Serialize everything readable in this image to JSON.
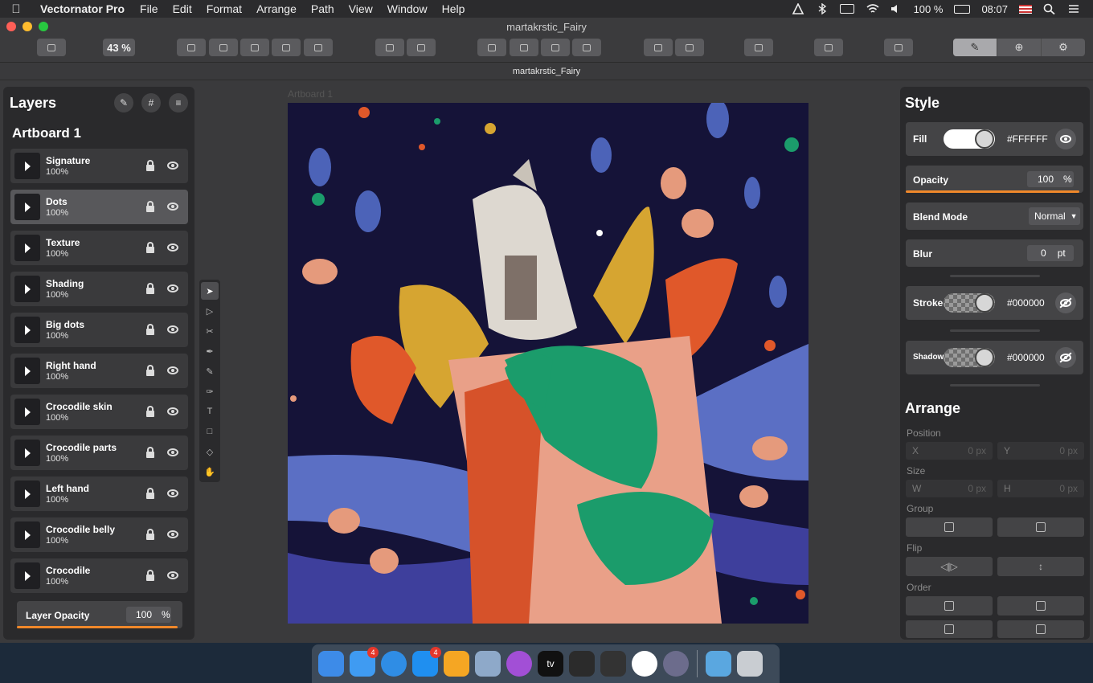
{
  "menubar": {
    "app_name": "Vectornator Pro",
    "menus": [
      "File",
      "Edit",
      "Format",
      "Arrange",
      "Path",
      "View",
      "Window",
      "Help"
    ],
    "battery": "100 %",
    "time": "08:07"
  },
  "window": {
    "title": "martakrstic_Fairy",
    "document_tab": "martakrstic_Fairy",
    "zoom": "43 %"
  },
  "layers_panel": {
    "title": "Layers",
    "artboard_name": "Artboard 1",
    "layers": [
      {
        "name": "Signature",
        "opacity": "100%"
      },
      {
        "name": "Dots",
        "opacity": "100%"
      },
      {
        "name": "Texture",
        "opacity": "100%"
      },
      {
        "name": "Shading",
        "opacity": "100%"
      },
      {
        "name": "Big dots",
        "opacity": "100%"
      },
      {
        "name": "Right hand",
        "opacity": "100%"
      },
      {
        "name": "Crocodile skin",
        "opacity": "100%"
      },
      {
        "name": "Crocodile parts",
        "opacity": "100%"
      },
      {
        "name": "Left hand",
        "opacity": "100%"
      },
      {
        "name": "Crocodile belly",
        "opacity": "100%"
      },
      {
        "name": "Crocodile",
        "opacity": "100%"
      }
    ],
    "layer_opacity_label": "Layer Opacity",
    "layer_opacity_value": "100",
    "percent_sign": "%"
  },
  "canvas": {
    "artboard_label": "Artboard 1"
  },
  "style_panel": {
    "title": "Style",
    "fill_label": "Fill",
    "fill_hex": "#FFFFFF",
    "opacity_label": "Opacity",
    "opacity_value": "100",
    "percent_sign": "%",
    "blend_label": "Blend Mode",
    "blend_value": "Normal",
    "blur_label": "Blur",
    "blur_value": "0",
    "blur_unit": "pt",
    "stroke_label": "Stroke",
    "stroke_hex": "#000000",
    "shadow_label": "Shadow",
    "shadow_hex": "#000000"
  },
  "arrange_panel": {
    "title": "Arrange",
    "position_label": "Position",
    "x_label": "X",
    "x_value": "0 px",
    "y_label": "Y",
    "y_value": "0 px",
    "size_label": "Size",
    "w_label": "W",
    "w_value": "0 px",
    "h_label": "H",
    "h_value": "0 px",
    "group_label": "Group",
    "flip_label": "Flip",
    "order_label": "Order"
  },
  "dock": {
    "messages_badge": "4",
    "appstore_badge": "4",
    "tv_label": "tv"
  },
  "colors": {
    "accent_orange": "#f0882a",
    "artboard_bg": "#151338"
  }
}
